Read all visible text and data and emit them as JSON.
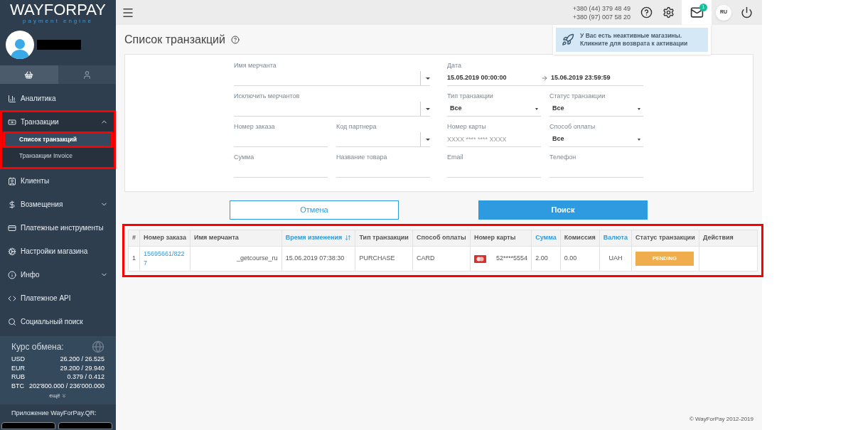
{
  "logo": {
    "name": "WAYFORPAY",
    "tagline": "payment engine"
  },
  "sidebar": {
    "tabs": [
      {
        "selected": true
      },
      {
        "selected": false
      }
    ],
    "items": [
      {
        "label": "Аналитика",
        "expandable": false,
        "expanded": false,
        "highlighted": false
      },
      {
        "label": "Транзакции",
        "expandable": true,
        "expanded": true,
        "highlighted": true,
        "children": [
          {
            "label": "Список транзакций",
            "selected": true,
            "highlighted": true
          },
          {
            "label": "Транзакции Invoice",
            "selected": false,
            "highlighted": false
          }
        ]
      },
      {
        "label": "Клиенты",
        "expandable": false,
        "expanded": false,
        "highlighted": false
      },
      {
        "label": "Возмещения",
        "expandable": true,
        "expanded": false,
        "highlighted": false
      },
      {
        "label": "Платежные инструменты",
        "expandable": false,
        "expanded": false,
        "highlighted": false
      },
      {
        "label": "Настройки магазина",
        "expandable": false,
        "expanded": false,
        "highlighted": false
      },
      {
        "label": "Инфо",
        "expandable": true,
        "expanded": false,
        "highlighted": false
      },
      {
        "label": "Платежное API",
        "expandable": false,
        "expanded": false,
        "highlighted": false
      },
      {
        "label": "Социальный поиск",
        "expandable": false,
        "expanded": false,
        "highlighted": false
      }
    ],
    "rates": {
      "title": "Курс обмена:",
      "rows": [
        {
          "currency": "USD",
          "value": "26.200 / 26.525"
        },
        {
          "currency": "EUR",
          "value": "29.200 / 29.940"
        },
        {
          "currency": "RUB",
          "value": "0.379 / 0.412"
        },
        {
          "currency": "BTC",
          "value": "202'800.000 / 236'000.000"
        }
      ],
      "more": "ещё"
    },
    "app_label": "Приложение WayForPay.QR:"
  },
  "header": {
    "phones": [
      "+380 (44) 379 48 49",
      "+380 (97) 007 58 20"
    ],
    "mail_count": "1",
    "language": "RU"
  },
  "notice": {
    "lines": [
      "У Вас есть неактивные магазины.",
      "Кликните для возврата к активации"
    ]
  },
  "page_title": "Список транзакций",
  "form": {
    "left_rows": [
      [
        {
          "kind": "combo",
          "label": "Имя мерчанта"
        }
      ],
      [
        {
          "kind": "combo",
          "label": "Исключить мерчантов"
        }
      ],
      [
        {
          "kind": "text",
          "label": "Номер заказа"
        },
        {
          "kind": "combo",
          "label": "Код партнера"
        }
      ],
      [
        {
          "kind": "text",
          "label": "Сумма"
        },
        {
          "kind": "text",
          "label": "Название товара"
        }
      ]
    ],
    "right_rows": [
      [
        {
          "kind": "date_range",
          "label": "Дата",
          "from": "15.05.2019 00:00:00",
          "to": "15.06.2019 23:59:59"
        }
      ],
      [
        {
          "kind": "select",
          "label": "Тип транзакции",
          "value": "Все"
        },
        {
          "kind": "select",
          "label": "Статус транзакции",
          "value": "Все"
        }
      ],
      [
        {
          "kind": "text",
          "label": "Номер карты",
          "placeholder": "XXXX **** **** XXXX"
        },
        {
          "kind": "select",
          "label": "Способ оплаты",
          "value": "Все"
        }
      ],
      [
        {
          "kind": "text",
          "label": "Email"
        },
        {
          "kind": "text",
          "label": "Телефон"
        }
      ]
    ],
    "cancel": "Отмена",
    "search": "Поиск"
  },
  "table": {
    "highlighted": true,
    "columns": [
      {
        "label": "#",
        "link": false,
        "sorted": false
      },
      {
        "label": "Номер заказа",
        "link": false,
        "sorted": false
      },
      {
        "label": "Имя мерчанта",
        "link": false,
        "sorted": false
      },
      {
        "label": "Время изменения",
        "link": true,
        "sorted": true
      },
      {
        "label": "Тип транзакции",
        "link": false,
        "sorted": false
      },
      {
        "label": "Способ оплаты",
        "link": false,
        "sorted": false
      },
      {
        "label": "Номер карты",
        "link": false,
        "sorted": false
      },
      {
        "label": "Сумма",
        "link": true,
        "sorted": false
      },
      {
        "label": "Комиссия",
        "link": false,
        "sorted": false
      },
      {
        "label": "Валюта",
        "link": true,
        "sorted": false
      },
      {
        "label": "Статус транзакции",
        "link": false,
        "sorted": false
      },
      {
        "label": "Действия",
        "link": false,
        "sorted": false
      }
    ],
    "rows": [
      {
        "index": "1",
        "order": "15695661/8227",
        "merchant": "_getcourse_ru",
        "time": "15.06.2019 07:38:30",
        "type": "PURCHASE",
        "method": "CARD",
        "card": "52****5554",
        "amount": "2.00",
        "fee": "0.00",
        "currency": "UAH",
        "status": "PENDING"
      }
    ]
  },
  "footer": "© WayForPay 2012-2019"
}
